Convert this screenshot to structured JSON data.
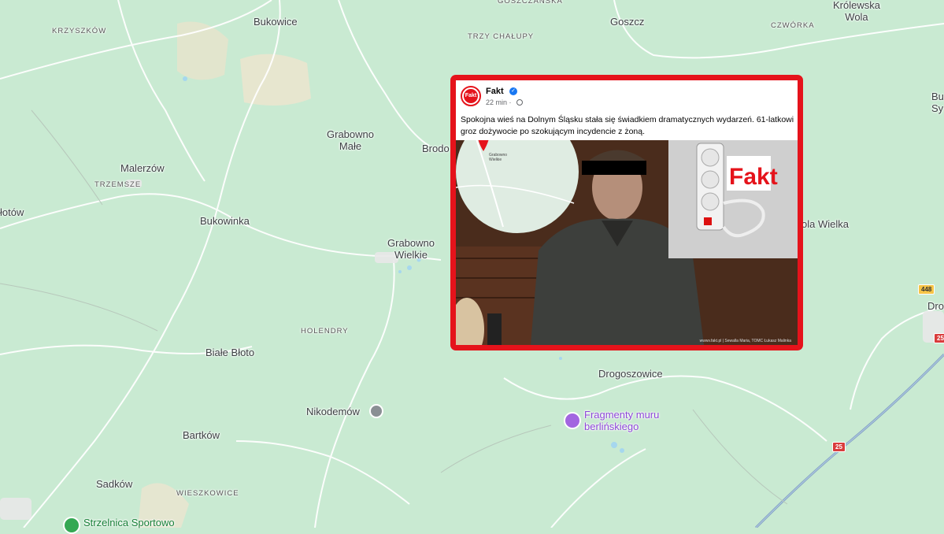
{
  "map": {
    "places": [
      {
        "name": "Bukowice"
      },
      {
        "name": "Goszcz"
      },
      {
        "name": "Królewska\nWola"
      },
      {
        "name": "TRZY CHAŁUPY"
      },
      {
        "name": "CZWÓRKA"
      },
      {
        "name": "KRZYSZKÓW"
      },
      {
        "name": "Grabowno\nMałe"
      },
      {
        "name": "Brodo"
      },
      {
        "name": "Malerzów"
      },
      {
        "name": "TRZEMSZE"
      },
      {
        "name": "łotów"
      },
      {
        "name": "Bukowinka"
      },
      {
        "name": "Grabowno\nWielkie"
      },
      {
        "name": "HOLENDRY"
      },
      {
        "name": "Białe Błoto"
      },
      {
        "name": "Nikodemów"
      },
      {
        "name": "Drogoszowice"
      },
      {
        "name": "Bartków"
      },
      {
        "name": "Sadków"
      },
      {
        "name": "WIESZKOWICE"
      },
      {
        "name": "ola Wielka"
      },
      {
        "name": "Bu\nSy"
      },
      {
        "name": "Dro"
      },
      {
        "name": "GOSZCZAŃSKA"
      }
    ],
    "poi": [
      {
        "name": "Fragmenty muru\nberlińskiego"
      },
      {
        "name": "Strzelnica Sportowo"
      }
    ],
    "road_shields": [
      {
        "number": "448",
        "color": "#f6c447"
      },
      {
        "number": "25",
        "color": "#d93c3c"
      },
      {
        "number": "25",
        "color": "#d93c3c"
      }
    ]
  },
  "post": {
    "page_name": "Fakt",
    "logo_text": "Fakt",
    "verified_icon": "verified-badge-icon",
    "time": "22 min ·",
    "privacy_icon": "globe-icon",
    "text": "Spokojna wieś na Dolnym Śląsku stała się świadkiem dramatycznych wydarzeń. 61-latkowi groz dożywocie po szokującym incydencie z żoną.",
    "image_brand": "Fakt",
    "inset_map_label": "Grabowno\nWielkie",
    "credit": "wwwv.fakt.pl | Sewalla Maria, TOMC Łukasz Malinka",
    "border_color": "#e5131b"
  }
}
